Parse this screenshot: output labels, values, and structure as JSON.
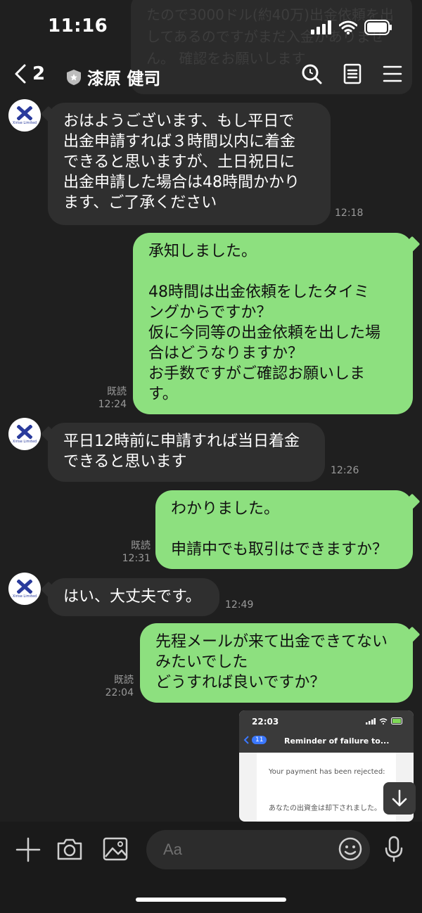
{
  "status_bar": {
    "time": "11:16"
  },
  "ghost_message": {
    "text": "たので3000ドル(約40万)出金依頼を出してあるのですがまだ入金がありません。\n確認をお願いします"
  },
  "header": {
    "back_count": "2",
    "contact_name": "漆原 健司",
    "icons": [
      "search-icon",
      "notes-icon",
      "menu-icon"
    ]
  },
  "avatar": {
    "logo_letter": "X",
    "caption": "Xirise Limited"
  },
  "messages": [
    {
      "direction": "in",
      "text": "おはようございます、もし平日で\n出金申請すれば３時間以内に着金\nできると思いますが、土日祝日に\n出金申請した場合は48時間かかり\nます、ご了承ください",
      "time": "12:18"
    },
    {
      "direction": "out",
      "text": "承知しました。\n\n48時間は出金依頼をしたタイミ\nングからですか？\n仮に今同等の出金依頼を出した場\n合はどうなりますか？\nお手数ですがご確認お願いしま\nす。",
      "read": "既読",
      "time": "12:24"
    },
    {
      "direction": "in",
      "text": "平日12時前に申請すれば当日着金\nできると思います",
      "time": "12:26"
    },
    {
      "direction": "out",
      "text": "わかりました。\n\n申請中でも取引はできますか？",
      "read": "既読",
      "time": "12:31"
    },
    {
      "direction": "in",
      "text": "はい、大丈夫です。",
      "time": "12:49"
    },
    {
      "direction": "out",
      "text": "先程メールが来て出金できてない\nみたいでした\nどうすれば良いですか？",
      "read": "既読",
      "time": "22:04"
    }
  ],
  "screenshot_attachment": {
    "time": "22:03",
    "badge": "11",
    "subject": "Reminder of failure to...",
    "line1": "Your payment has been rejected:",
    "line2": "あなたの出資金は却下されました。"
  },
  "input_bar": {
    "placeholder": "Aa"
  }
}
